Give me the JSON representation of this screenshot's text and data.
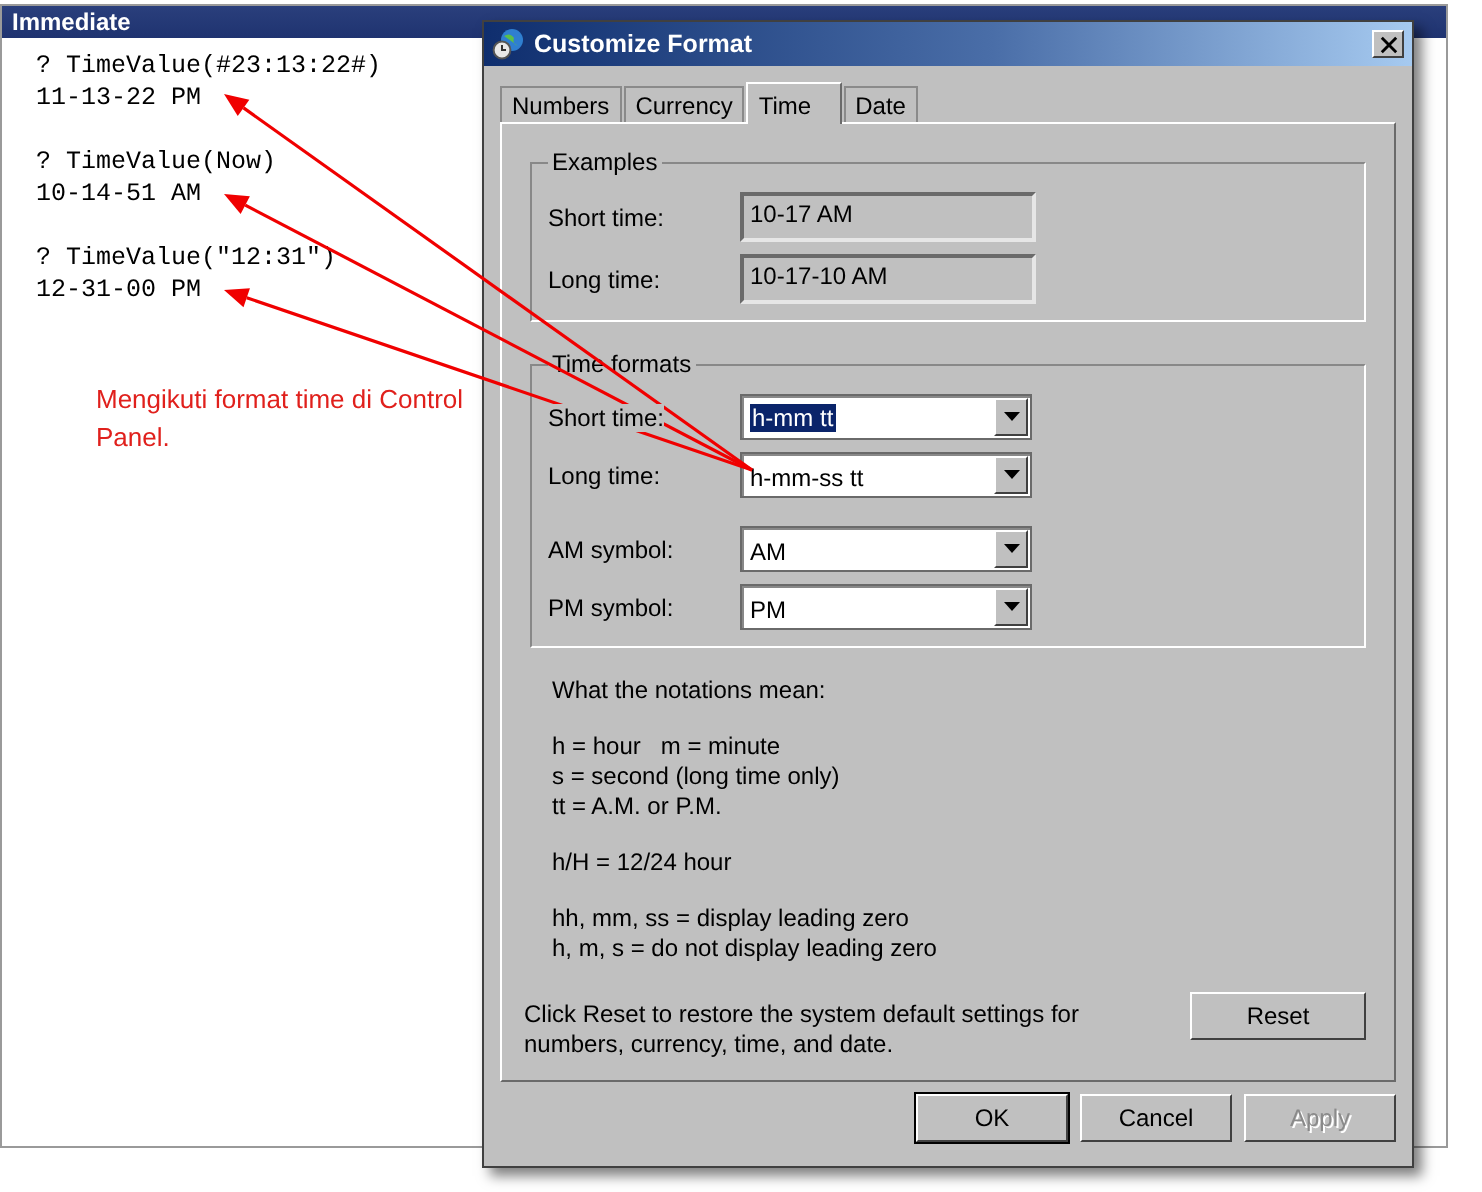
{
  "immediate": {
    "title": "Immediate",
    "entries": [
      {
        "command": "? TimeValue(#23:13:22#)",
        "result": "11-13-22 PM"
      },
      {
        "command": "? TimeValue(Now)",
        "result": "10-14-51 AM"
      },
      {
        "command": "? TimeValue(\"12:31\")",
        "result": "12-31-00 PM"
      }
    ]
  },
  "annotation": {
    "text": "Mengikuti format time di Control Panel."
  },
  "dialog": {
    "title": "Customize Format",
    "tabs": [
      {
        "label": "Numbers",
        "selected": false
      },
      {
        "label": "Currency",
        "selected": false
      },
      {
        "label": "Time",
        "selected": true
      },
      {
        "label": "Date",
        "selected": false
      }
    ],
    "examples": {
      "title": "Examples",
      "fields": [
        {
          "label": "Short time:",
          "value": "10-17 AM"
        },
        {
          "label": "Long time:",
          "value": "10-17-10 AM"
        }
      ]
    },
    "time_formats": {
      "title": "Time formats",
      "field_groups": [
        [
          {
            "label": "Short time:",
            "value": "h-mm tt",
            "highlighted": true
          },
          {
            "label": "Long time:",
            "value": "h-mm-ss tt",
            "highlighted": false
          }
        ],
        [
          {
            "label": "AM symbol:",
            "value": "AM",
            "highlighted": false
          },
          {
            "label": "PM symbol:",
            "value": "PM",
            "highlighted": false
          }
        ]
      ]
    },
    "notes": [
      [
        "What the notations mean:"
      ],
      [
        "h = hour   m = minute",
        "s = second (long time only)",
        "tt = A.M. or P.M."
      ],
      [
        "h/H = 12/24 hour"
      ],
      [
        "hh, mm, ss = display leading zero",
        "h, m, s = do not display leading zero"
      ]
    ],
    "reset_note": "Click Reset to restore the system default settings for numbers, currency, time, and date.",
    "reset_button": "Reset",
    "buttons": [
      {
        "label": "OK",
        "disabled": false,
        "default": true
      },
      {
        "label": "Cancel",
        "disabled": false,
        "default": false
      },
      {
        "label": "Apply",
        "disabled": true,
        "default": false
      }
    ]
  }
}
